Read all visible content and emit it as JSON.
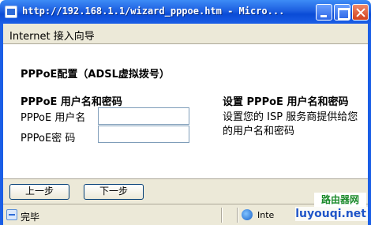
{
  "window": {
    "title": "http://192.168.1.1/wizard_pppoe.htm - Micro..."
  },
  "header": {
    "title": "Internet 接入向导"
  },
  "content": {
    "section_title": "PPPoE配置（ADSL虚拟拨号）",
    "sub_title": "PPPoE 用户名和密码",
    "username_label": "PPPoE 用户名",
    "password_label": "PPPoE密  码",
    "username_value": "",
    "password_value": "",
    "right_title": "设置 PPPoE 用户名和密码",
    "right_desc": "设置您的 ISP 服务商提供给您的用户名和密码"
  },
  "buttons": {
    "prev_label": "上一步",
    "next_label": "下一步"
  },
  "status": {
    "text": "完毕",
    "zone_text": "Inte"
  },
  "watermark": {
    "badge_top": "路由器网",
    "badge_bottom": "luyouqi.net"
  },
  "colors": {
    "titlebar": "#1d5fe0",
    "panel": "#ece9d8",
    "close_button": "#d2411c"
  }
}
